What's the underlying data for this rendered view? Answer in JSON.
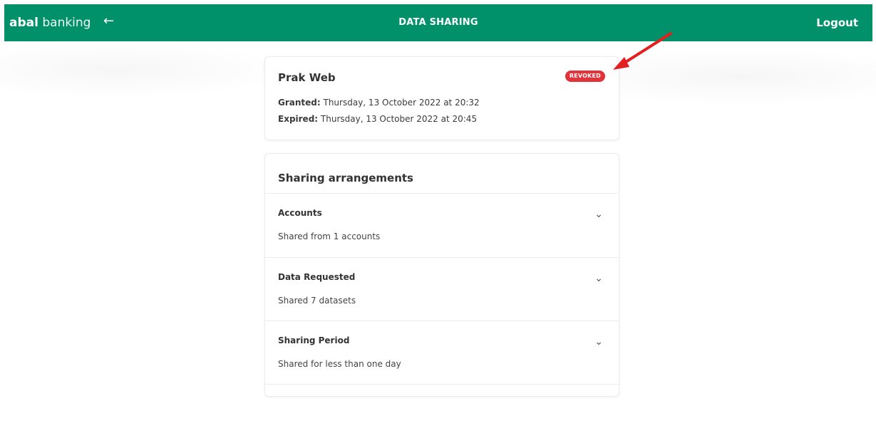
{
  "header": {
    "brand_bold": "abal",
    "brand_light": "banking",
    "back_icon": "←",
    "title": "DATA SHARING",
    "logout": "Logout"
  },
  "consent": {
    "app_name": "Prak Web",
    "status": "REVOKED",
    "granted_label": "Granted:",
    "granted_value": "Thursday, 13 October 2022 at 20:32",
    "expired_label": "Expired:",
    "expired_value": "Thursday, 13 October 2022 at 20:45"
  },
  "arrangements": {
    "title": "Sharing arrangements",
    "items": [
      {
        "title": "Accounts",
        "subtitle": "Shared from 1 accounts"
      },
      {
        "title": "Data Requested",
        "subtitle": "Shared 7 datasets"
      },
      {
        "title": "Sharing Period",
        "subtitle": "Shared for less than one day"
      }
    ],
    "chevron": "⌄"
  },
  "colors": {
    "header_bg": "#00916a",
    "badge_bg": "#e2333b",
    "annotation_arrow": "#e3201f"
  }
}
